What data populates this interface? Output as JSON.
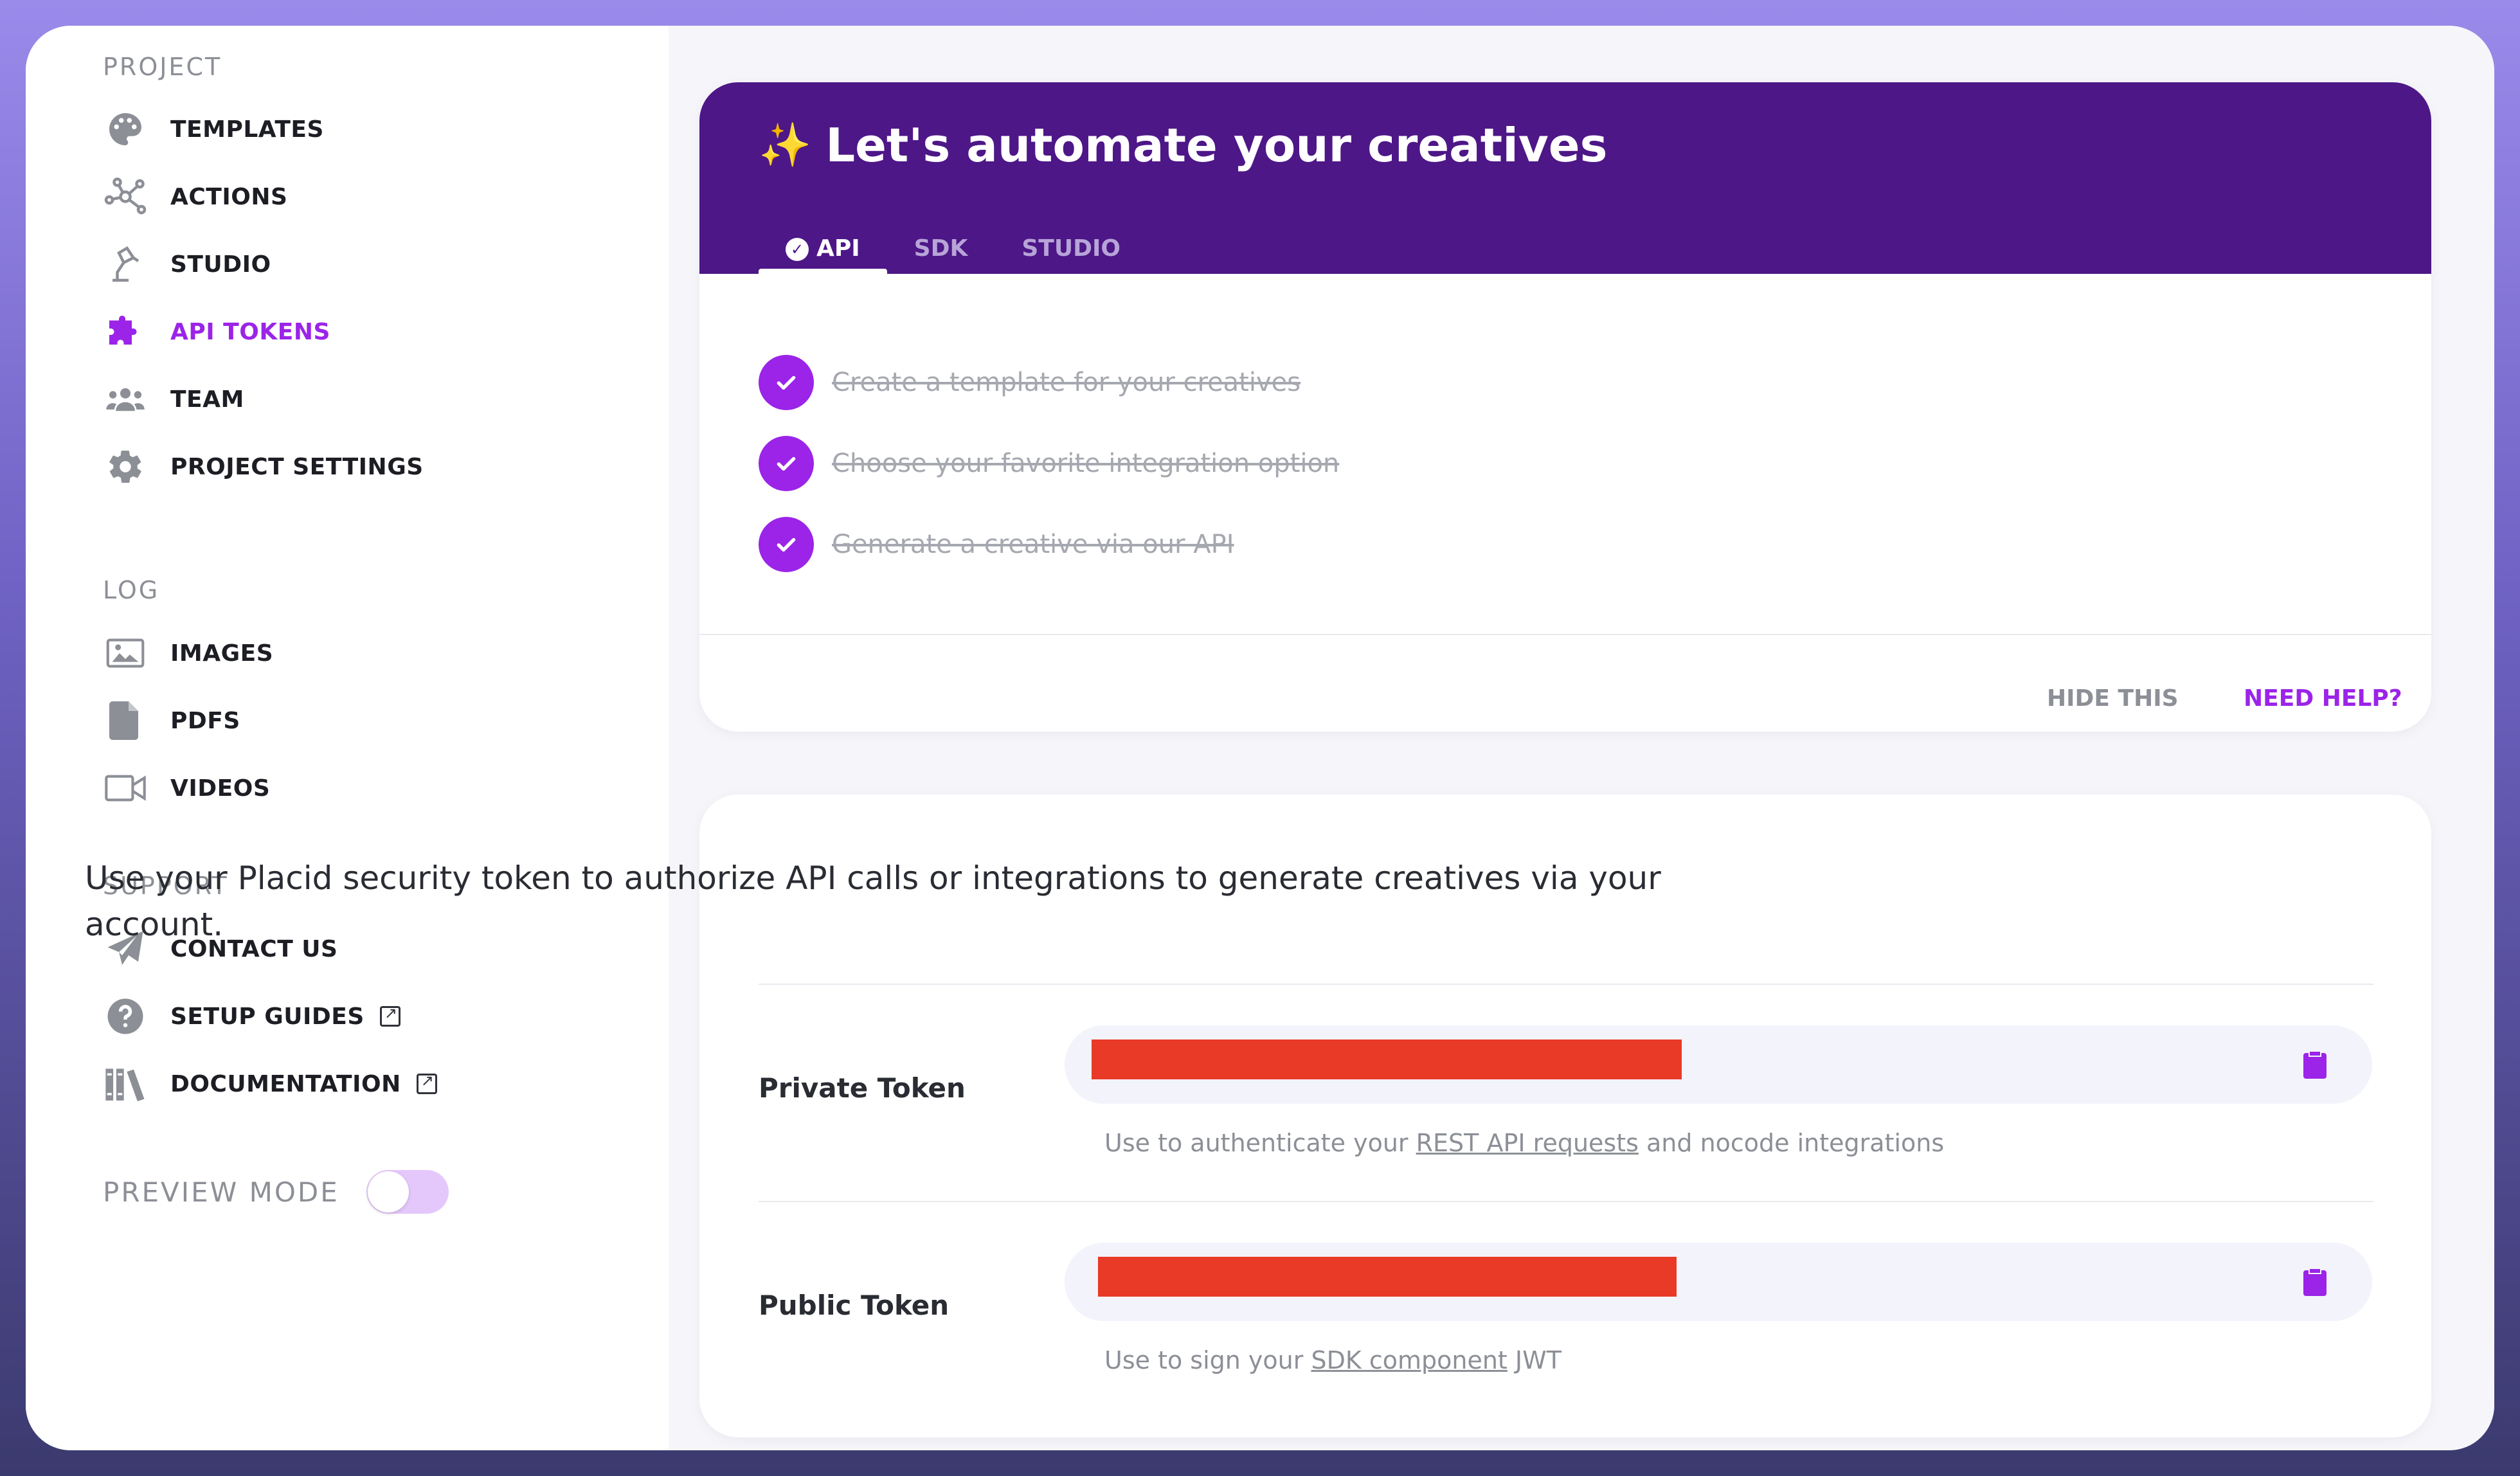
{
  "sidebar": {
    "sections": {
      "project": "PROJECT",
      "log": "LOG",
      "support": "SUPPORT"
    },
    "items": [
      {
        "label": "TEMPLATES",
        "icon": "palette-icon"
      },
      {
        "label": "ACTIONS",
        "icon": "network-icon"
      },
      {
        "label": "STUDIO",
        "icon": "lamp-icon"
      },
      {
        "label": "API TOKENS",
        "icon": "puzzle-icon",
        "active": true
      },
      {
        "label": "TEAM",
        "icon": "users-icon"
      },
      {
        "label": "PROJECT SETTINGS",
        "icon": "gear-icon"
      },
      {
        "label": "IMAGES",
        "icon": "image-icon"
      },
      {
        "label": "PDFS",
        "icon": "file-icon"
      },
      {
        "label": "VIDEOS",
        "icon": "video-icon"
      },
      {
        "label": "CONTACT US",
        "icon": "paper-plane-icon"
      },
      {
        "label": "SETUP GUIDES",
        "icon": "question-icon",
        "external": true
      },
      {
        "label": "DOCUMENTATION",
        "icon": "books-icon",
        "external": true
      }
    ],
    "preview_mode": {
      "label": "PREVIEW MODE",
      "enabled": false
    }
  },
  "onboarding": {
    "title": "Let's automate your creatives",
    "title_icon": "sparkles-icon",
    "tabs": [
      "API",
      "SDK",
      "STUDIO"
    ],
    "active_tab": "API",
    "steps": [
      "Create a template for your creatives",
      "Choose your favorite integration option",
      "Generate a creative via our API"
    ],
    "hide_label": "HIDE THIS",
    "help_label": "NEED HELP?"
  },
  "tokens": {
    "intro": "Use your Placid security token to authorize API calls or integrations to generate creatives via your account.",
    "private": {
      "label": "Private Token",
      "hint_prefix": "Use to authenticate your ",
      "hint_link": "REST API requests",
      "hint_suffix": " and nocode integrations"
    },
    "public": {
      "label": "Public Token",
      "hint_prefix": "Use to sign your ",
      "hint_link": "SDK component",
      "hint_suffix": " JWT"
    }
  },
  "colors": {
    "accent": "#9b24e8",
    "header": "#4d1787",
    "redaction": "#e83a26"
  }
}
